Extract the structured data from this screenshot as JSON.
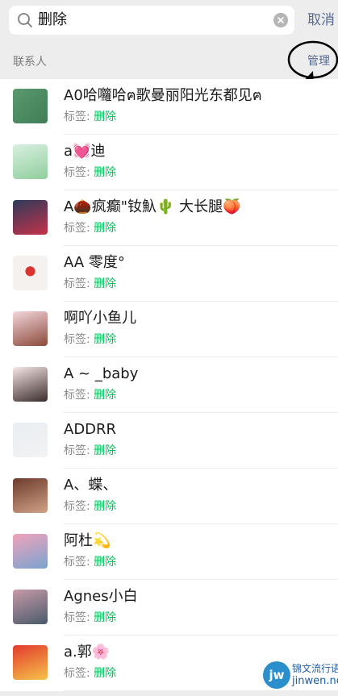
{
  "search": {
    "query": "删除",
    "cancel_label": "取消"
  },
  "section": {
    "title": "联系人",
    "manage_label": "管理"
  },
  "tag_prefix": "标签: ",
  "tag_value": "删除",
  "contacts": [
    {
      "name": "A0哈囖哈ฅ歌曼丽阳光东都见ฅ"
    },
    {
      "name": "a💓迪"
    },
    {
      "name": "A🌰疯癫\"钕魞🌵 大长腿🍑"
    },
    {
      "name": "AA 零度°"
    },
    {
      "name": "啊吖小鱼儿"
    },
    {
      "name": "A ~ _baby"
    },
    {
      "name": "ADDRR"
    },
    {
      "name": "A、蝶、"
    },
    {
      "name": "阿杜💫"
    },
    {
      "name": "Agnes小白"
    },
    {
      "name": "a.郭🌸"
    }
  ],
  "watermark": {
    "logo": "jw",
    "line1": "锦文流行语",
    "line2": "jinwen.net"
  },
  "colors": {
    "background": "#ededed",
    "link": "#576b95",
    "highlight": "#07c160",
    "annotation": "#000000"
  },
  "icons": [
    "search-icon",
    "clear-icon"
  ]
}
